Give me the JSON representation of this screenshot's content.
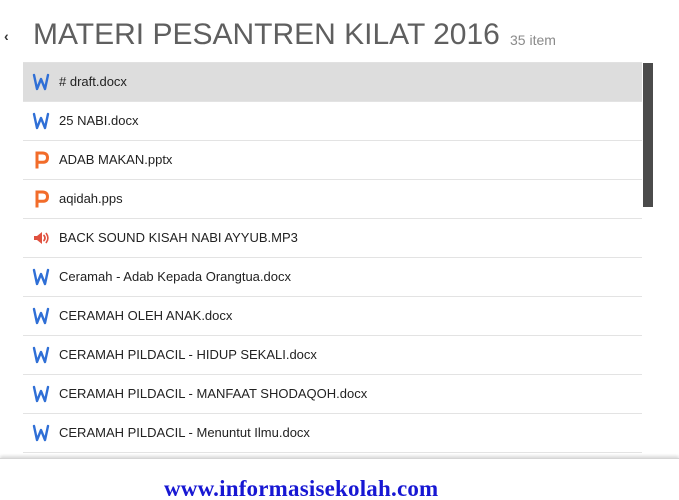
{
  "header": {
    "back_glyph": "‹",
    "title": "MATERI PESANTREN KILAT 2016",
    "count": "35 item"
  },
  "files": [
    {
      "name": "# draft.docx",
      "icon": "word-icon",
      "selected": true
    },
    {
      "name": "25 NABI.docx",
      "icon": "word-icon",
      "selected": false
    },
    {
      "name": "ADAB MAKAN.pptx",
      "icon": "powerpoint-icon",
      "selected": false
    },
    {
      "name": "aqidah.pps",
      "icon": "powerpoint-icon",
      "selected": false
    },
    {
      "name": "BACK SOUND KISAH NABI AYYUB.MP3",
      "icon": "audio-icon",
      "selected": false
    },
    {
      "name": "Ceramah - Adab Kepada Orangtua.docx",
      "icon": "word-icon",
      "selected": false
    },
    {
      "name": "CERAMAH OLEH ANAK.docx",
      "icon": "word-icon",
      "selected": false
    },
    {
      "name": "CERAMAH PILDACIL - HIDUP SEKALI.docx",
      "icon": "word-icon",
      "selected": false
    },
    {
      "name": "CERAMAH PILDACIL - MANFAAT SHODAQOH.docx",
      "icon": "word-icon",
      "selected": false
    },
    {
      "name": "CERAMAH PILDACIL - Menuntut Ilmu.docx",
      "icon": "word-icon",
      "selected": false
    }
  ],
  "watermark": {
    "text": "www.informasisekolah.com"
  },
  "colors": {
    "word": "#2f6fd6",
    "powerpoint": "#f26c2a",
    "audio": "#e0513f",
    "selected_row": "#dddddd",
    "scrollbar": "#4b4b4b",
    "watermark": "#1717d3"
  }
}
